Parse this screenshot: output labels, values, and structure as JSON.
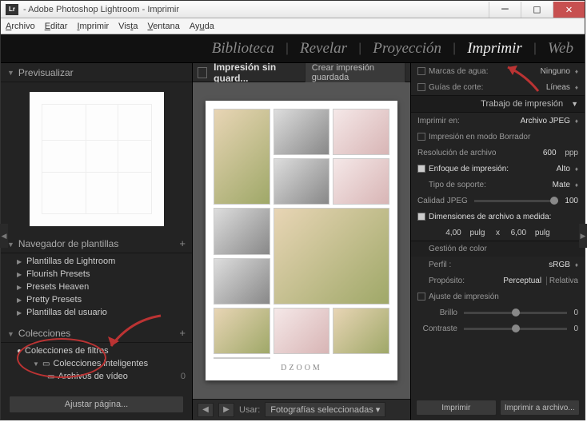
{
  "titlebar": {
    "logo": "Lr",
    "title": " - Adobe Photoshop Lightroom - Imprimir"
  },
  "menubar": [
    "Archivo",
    "Editar",
    "Imprimir",
    "Vista",
    "Ventana",
    "Ayuda"
  ],
  "modules": {
    "items": [
      "Biblioteca",
      "Revelar",
      "Proyección",
      "Imprimir",
      "Web"
    ],
    "activeIndex": 3
  },
  "left": {
    "preview": "Previsualizar",
    "templates": "Navegador de plantillas",
    "templateItems": [
      "Plantillas de Lightroom",
      "Flourish Presets",
      "Presets Heaven",
      "Pretty Presets",
      "Plantillas del usuario"
    ],
    "collections": "Colecciones",
    "colList": {
      "filters": "Colecciones de filtros",
      "smart": "Colecciones inteligentes",
      "video": "Archivos de vídeo",
      "videoCount": "0"
    },
    "footBtn": "Ajustar página..."
  },
  "center": {
    "unsaved": "Impresión sin guard...",
    "saveBtn": "Crear impresión guardada",
    "pageFoot": "DZOOM",
    "useLbl": "Usar:",
    "useSel": "Fotografías seleccionadas"
  },
  "right": {
    "watermark": {
      "lbl": "Marcas de agua:",
      "val": "Ninguno"
    },
    "guides": {
      "lbl": "Guías de corte:",
      "val": "Líneas"
    },
    "jobHead": "Trabajo de impresión",
    "printTo": {
      "lbl": "Imprimir en:",
      "val": "Archivo JPEG"
    },
    "draft": "Impresión en modo Borrador",
    "resolution": {
      "lbl": "Resolución de archivo",
      "val": "600",
      "unit": "ppp"
    },
    "sharpen": {
      "lbl": "Enfoque de impresión:",
      "val": "Alto"
    },
    "media": {
      "lbl": "Tipo de soporte:",
      "val": "Mate"
    },
    "jpeg": {
      "lbl": "Calidad JPEG",
      "val": "100"
    },
    "dims": {
      "lbl": "Dimensiones de archivo a medida:",
      "w": "4,00",
      "h": "6,00",
      "unit": "pulg",
      "sep": "x"
    },
    "colorHead": "Gestión de color",
    "profile": {
      "lbl": "Perfil :",
      "val": "sRGB"
    },
    "intent": {
      "lbl": "Propósito:",
      "perc": "Perceptual",
      "rel": "Relativa"
    },
    "adjust": "Ajuste de impresión",
    "bright": {
      "lbl": "Brillo",
      "val": "0"
    },
    "contrast": {
      "lbl": "Contraste",
      "val": "0"
    },
    "printBtn": "Imprimir",
    "fileBtn": "Imprimir a archivo..."
  }
}
